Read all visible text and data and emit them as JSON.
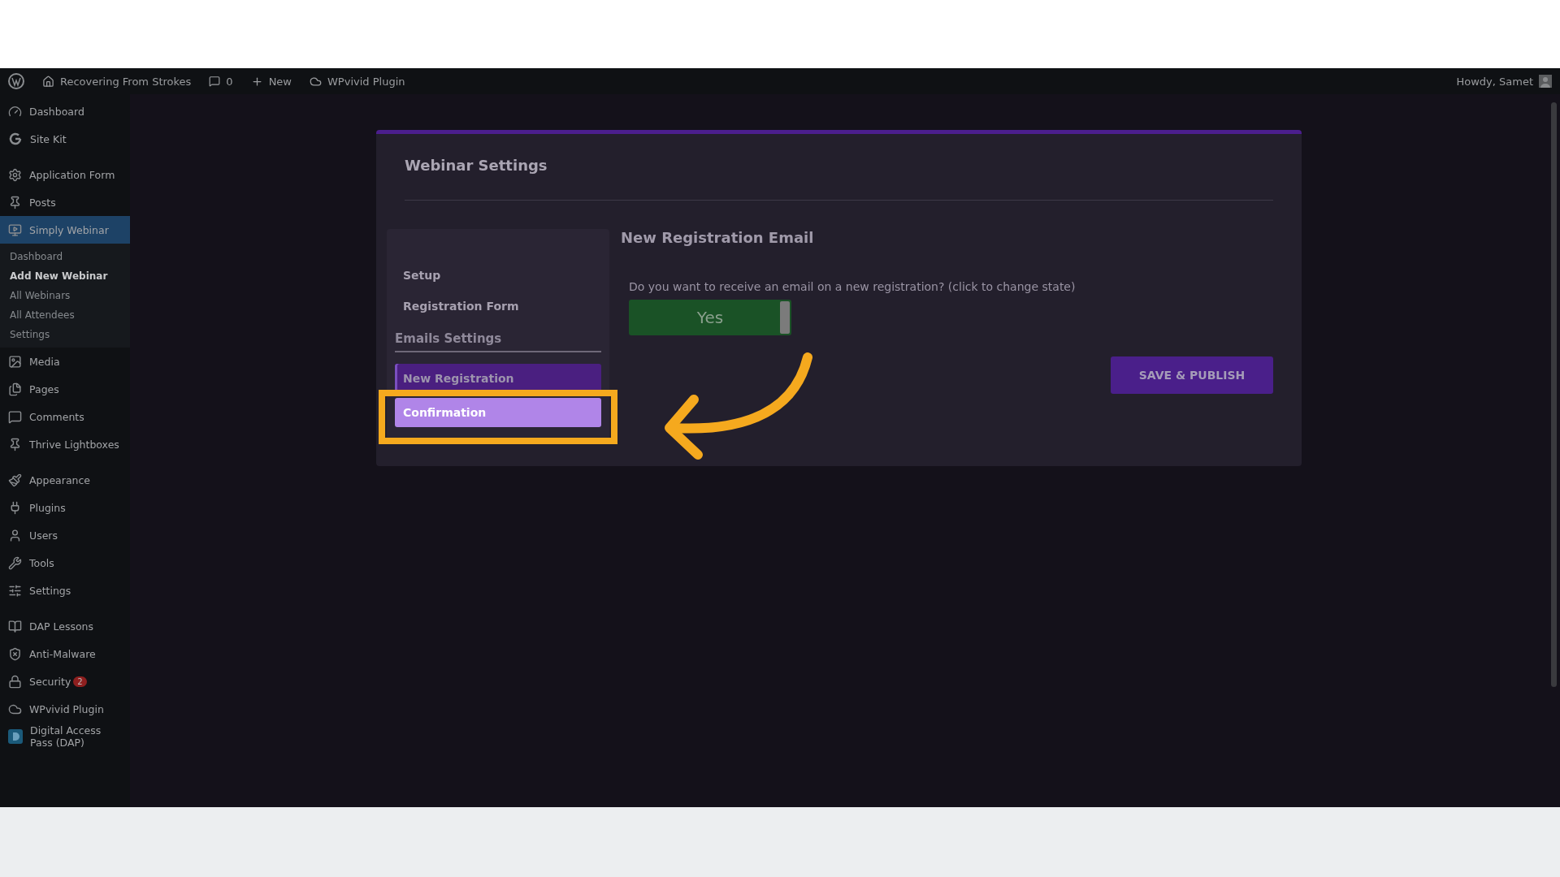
{
  "admin_bar": {
    "site": "Recovering From Strokes",
    "comments": "0",
    "new": "New",
    "plugin": "WPvivid Plugin",
    "greeting": "Howdy, Samet"
  },
  "sidebar": {
    "groups": [
      [
        {
          "label": "Dashboard",
          "selected": false
        },
        {
          "label": "Site Kit",
          "selected": false
        }
      ],
      [
        {
          "label": "Application Form",
          "selected": false
        },
        {
          "label": "Posts",
          "selected": false
        },
        {
          "label": "Simply Webinar",
          "selected": true,
          "children": [
            {
              "label": "Dashboard",
              "selected": false
            },
            {
              "label": "Add New Webinar",
              "selected": true
            },
            {
              "label": "All Webinars",
              "selected": false
            },
            {
              "label": "All Attendees",
              "selected": false
            },
            {
              "label": "Settings",
              "selected": false
            }
          ]
        },
        {
          "label": "Media",
          "selected": false
        },
        {
          "label": "Pages",
          "selected": false
        },
        {
          "label": "Comments",
          "selected": false
        },
        {
          "label": "Thrive Lightboxes",
          "selected": false
        }
      ],
      [
        {
          "label": "Appearance",
          "selected": false
        },
        {
          "label": "Plugins",
          "selected": false
        },
        {
          "label": "Users",
          "selected": false
        },
        {
          "label": "Tools",
          "selected": false
        },
        {
          "label": "Settings",
          "selected": false
        }
      ],
      [
        {
          "label": "DAP Lessons",
          "selected": false
        },
        {
          "label": "Anti-Malware",
          "selected": false
        },
        {
          "label": "Security",
          "selected": false,
          "badge": "2"
        },
        {
          "label": "WPvivid Plugin",
          "selected": false
        },
        {
          "label": "Digital Access Pass (DAP)",
          "selected": false
        }
      ]
    ]
  },
  "card": {
    "title": "Webinar Settings",
    "nav": {
      "links": [
        {
          "label": "Setup"
        },
        {
          "label": "Registration Form"
        }
      ],
      "section": "Emails Settings",
      "items": [
        {
          "label": "New Registration",
          "selected": true,
          "highlighted": false
        },
        {
          "label": "Confirmation",
          "selected": false,
          "highlighted": true
        }
      ]
    },
    "heading": "New Registration Email",
    "question": "Do you want to receive an email on a new registration? (click to change state)",
    "toggle": {
      "label": "Yes",
      "on": true
    },
    "save": "SAVE & PUBLISH"
  },
  "annotation": {
    "shown": true
  }
}
